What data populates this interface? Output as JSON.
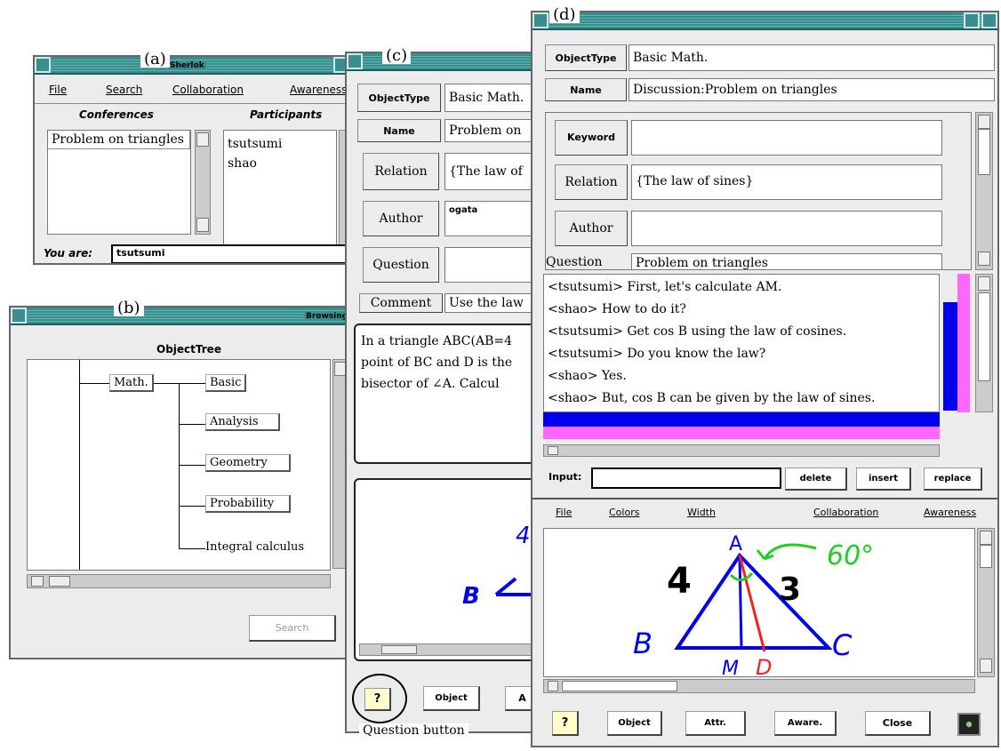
{
  "panels": {
    "a": "(a)",
    "b": "(b)",
    "c": "(c)",
    "d": "(d)"
  },
  "win_a": {
    "title": "Sherlok",
    "menu": [
      "File",
      "Search",
      "Collaboration",
      "Awareness"
    ],
    "conferences_label": "Conferences",
    "participants_label": "Participants",
    "conferences": [
      "Problem on triangles"
    ],
    "participants": [
      "tsutsumi",
      "shao"
    ],
    "you_are_label": "You are:",
    "you_are_value": "tsutsumi"
  },
  "win_b": {
    "title": "BrowsingWi",
    "tree_title": "ObjectTree",
    "root": "Math.",
    "children": [
      "Basic",
      "Analysis",
      "Geometry",
      "Probability",
      "Integral calculus"
    ],
    "search_label": "Search"
  },
  "win_c": {
    "fields": [
      {
        "label": "ObjectType",
        "value": "Basic Math."
      },
      {
        "label": "Name",
        "value": "Problem on"
      },
      {
        "label": "Relation",
        "value": "{The law of"
      },
      {
        "label": "Author",
        "value": "ogata"
      },
      {
        "label": "Question",
        "value": ""
      },
      {
        "label": "Comment",
        "value": "Use the law"
      }
    ],
    "problem_lines": [
      "In a triangle ABC(AB=4",
      "point of BC and D is the",
      "bisector of ∠A. Calcul"
    ],
    "q_btn": "?",
    "object_btn": "Object",
    "attr_btn": "A",
    "caption": "Question button",
    "sketch": {
      "label_b": "B",
      "label_4": "4"
    }
  },
  "win_d": {
    "objecttype_label": "ObjectType",
    "objecttype_value": "Basic Math.",
    "name_label": "Name",
    "name_value": "Discussion:Problem on triangles",
    "keyword_label": "Keyword",
    "keyword_value": "",
    "relation_label": "Relation",
    "relation_value": "{The law of sines}",
    "author_label": "Author",
    "author_value": "",
    "question_label": "Question",
    "question_value": "Problem on triangles",
    "chat": [
      "<tsutsumi> First, let's calculate AM.",
      "<shao> How to do it?",
      "<tsutsumi> Get cos B using the law of cosines.",
      "<tsutsumi> Do you know the law?",
      "<shao> Yes.",
      "<shao> But, cos B can be given by the law of sines."
    ],
    "input_label": "Input:",
    "input_value": "",
    "delete_label": "delete",
    "insert_label": "insert",
    "replace_label": "replace",
    "menu": [
      "File",
      "Colors",
      "Width",
      "Collaboration",
      "Awareness"
    ],
    "sketch": {
      "A": "A",
      "B": "B",
      "C": "C",
      "M": "M",
      "D": "D",
      "four": "4",
      "three": "3",
      "angle": "60°"
    },
    "q_btn": "?",
    "object_btn": "Object",
    "attr_btn": "Attr.",
    "aware_btn": "Aware.",
    "close_btn": "Close"
  },
  "colors": {
    "title": "#3a8e8e",
    "blue": "#0000ee",
    "magenta": "#ff66ff",
    "green": "#22cc22",
    "red": "#ee2222"
  }
}
